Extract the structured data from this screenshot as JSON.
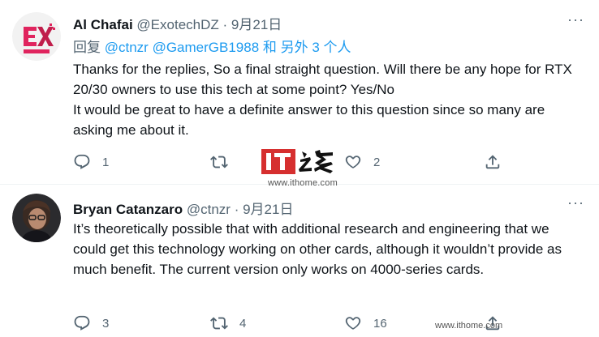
{
  "tweet1": {
    "name": "Al Chafai",
    "handle": "@ExotechDZ",
    "separator": "·",
    "date": "9月21日",
    "more": "···",
    "reply_prefix": "回复",
    "reply_link1": "@ctnzr",
    "reply_link2": "@GamerGB1988",
    "reply_suffix": "和 另外 3 个人",
    "body": "Thanks for the replies, So a final straight question. Will there be any hope for RTX 20/30 owners to use this tech at some point? Yes/No\nIt would be great to have a definite answer to this question since so many are asking me about it.",
    "replies": "1",
    "retweets": "",
    "likes": "2",
    "avatar_text": "EXOTECH DZ"
  },
  "tweet2": {
    "name": "Bryan Catanzaro",
    "handle": "@ctnzr",
    "separator": "·",
    "date": "9月21日",
    "more": "···",
    "body": "It’s theoretically possible that with additional research and engineering that we could get this technology working on other cards, although it wouldn’t provide as much benefit. The current version only works on 4000-series cards.",
    "replies": "3",
    "retweets": "4",
    "likes": "16"
  },
  "watermark": {
    "logo_text": "IT之家",
    "url": "www.ithome.com"
  },
  "colors": {
    "text": "#0f1419",
    "secondary": "#536471",
    "link": "#1d9bf0",
    "watermark_red": "#d62f2f"
  }
}
